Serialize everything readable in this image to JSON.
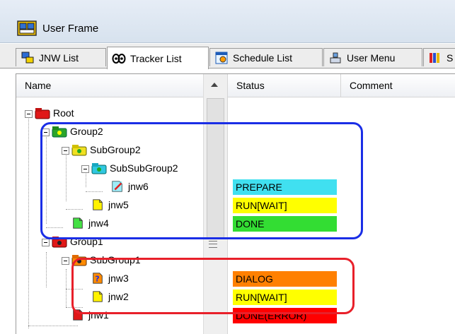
{
  "window": {
    "title": "User Frame"
  },
  "tabs": [
    {
      "label": "JNW List",
      "icon": "jnw-list-icon"
    },
    {
      "label": "Tracker List",
      "icon": "tracker-icon"
    },
    {
      "label": "Schedule List",
      "icon": "schedule-icon"
    },
    {
      "label": "User Menu",
      "icon": "user-menu-icon"
    },
    {
      "label": "S",
      "icon": "books-icon"
    }
  ],
  "columns": {
    "name": "Name",
    "status": "Status",
    "comment": "Comment"
  },
  "tree": [
    {
      "label": "Root",
      "status": "",
      "status_color": ""
    },
    {
      "label": "Group2",
      "status": "",
      "status_color": ""
    },
    {
      "label": "SubGroup2",
      "status": "",
      "status_color": ""
    },
    {
      "label": "SubSubGroup2",
      "status": "",
      "status_color": ""
    },
    {
      "label": "jnw6",
      "status": "PREPARE",
      "status_color": "#40e0f0"
    },
    {
      "label": "jnw5",
      "status": "RUN[WAIT]",
      "status_color": "#ffff00"
    },
    {
      "label": "jnw4",
      "status": "DONE",
      "status_color": "#33dd33"
    },
    {
      "label": "Group1",
      "status": "",
      "status_color": ""
    },
    {
      "label": "SubGroup1",
      "status": "",
      "status_color": ""
    },
    {
      "label": "jnw3",
      "status": "DIALOG",
      "status_color": "#ff8000"
    },
    {
      "label": "jnw2",
      "status": "RUN[WAIT]",
      "status_color": "#ffff00"
    },
    {
      "label": "jnw1",
      "status": "DONE(ERROR)",
      "status_color": "#ff0000"
    }
  ],
  "highlights": {
    "blue": "#1a2ee6",
    "red": "#e8202a"
  }
}
